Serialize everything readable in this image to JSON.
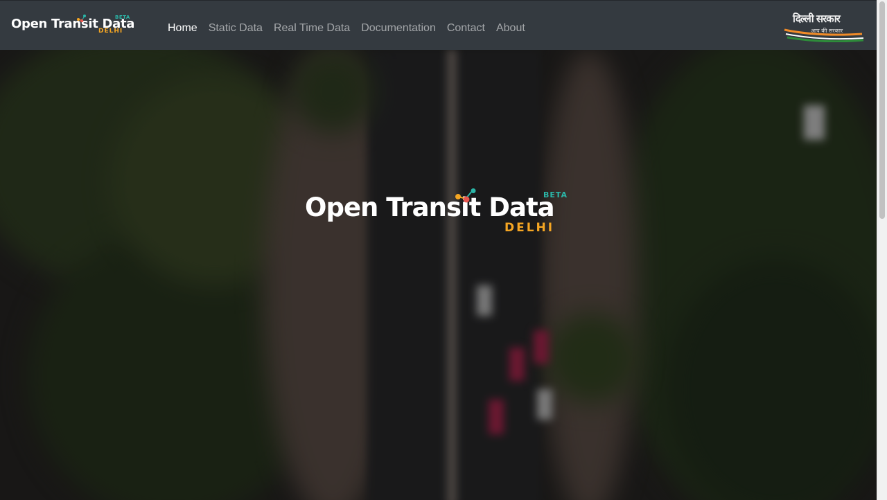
{
  "brand": {
    "name": "Open Transit Data",
    "badge": "BETA",
    "city": "DELHI"
  },
  "nav": {
    "items": [
      "Home",
      "Static Data",
      "Real Time Data",
      "Documentation",
      "Contact",
      "About"
    ],
    "active": "Home"
  },
  "gov_logo": {
    "title": "दिल्ली सरकार",
    "tagline": "आप की सरकार"
  },
  "hero": {
    "name": "Open Transit Data",
    "badge": "BETA",
    "city": "DELHI"
  },
  "colors": {
    "navbar": "#343a40",
    "accent_teal": "#2bb6a8",
    "accent_orange": "#f5a623",
    "accent_red": "#e8554e"
  }
}
